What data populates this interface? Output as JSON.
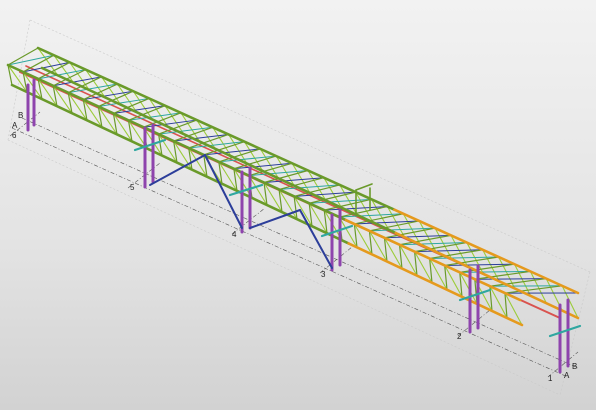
{
  "viewport": {
    "gridlines_numbered": [
      "1",
      "2",
      "3",
      "4",
      "5",
      "6"
    ],
    "gridlines_lettered": [
      "A",
      "B"
    ],
    "colors": {
      "background_top": "#f2f2f2",
      "background_bottom": "#d2d2d2",
      "chord_green": "#6a9a2a",
      "chord_orange": "#e59a1d",
      "beam_red": "#d9534f",
      "brace_blue": "#2c3e9a",
      "column_purple": "#8e44ad",
      "tie_teal": "#2fa7a0",
      "brace_light_green": "#9ccc3a"
    }
  }
}
